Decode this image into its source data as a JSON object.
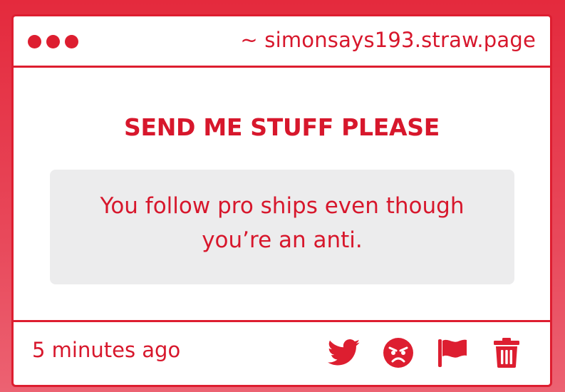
{
  "window": {
    "url": "~ simonsays193.straw.page"
  },
  "post": {
    "heading": "SEND ME STUFF PLEASE",
    "message": "You follow pro ships even though you’re an anti.",
    "timestamp": "5 minutes ago"
  },
  "actions": [
    {
      "icon": "twitter-icon"
    },
    {
      "icon": "angry-face-icon"
    },
    {
      "icon": "flag-icon"
    },
    {
      "icon": "trash-icon"
    }
  ],
  "colors": {
    "accent": "#dd1e30",
    "text": "#d7172c",
    "message_bg": "#ececed",
    "card_bg": "#ffffff"
  }
}
